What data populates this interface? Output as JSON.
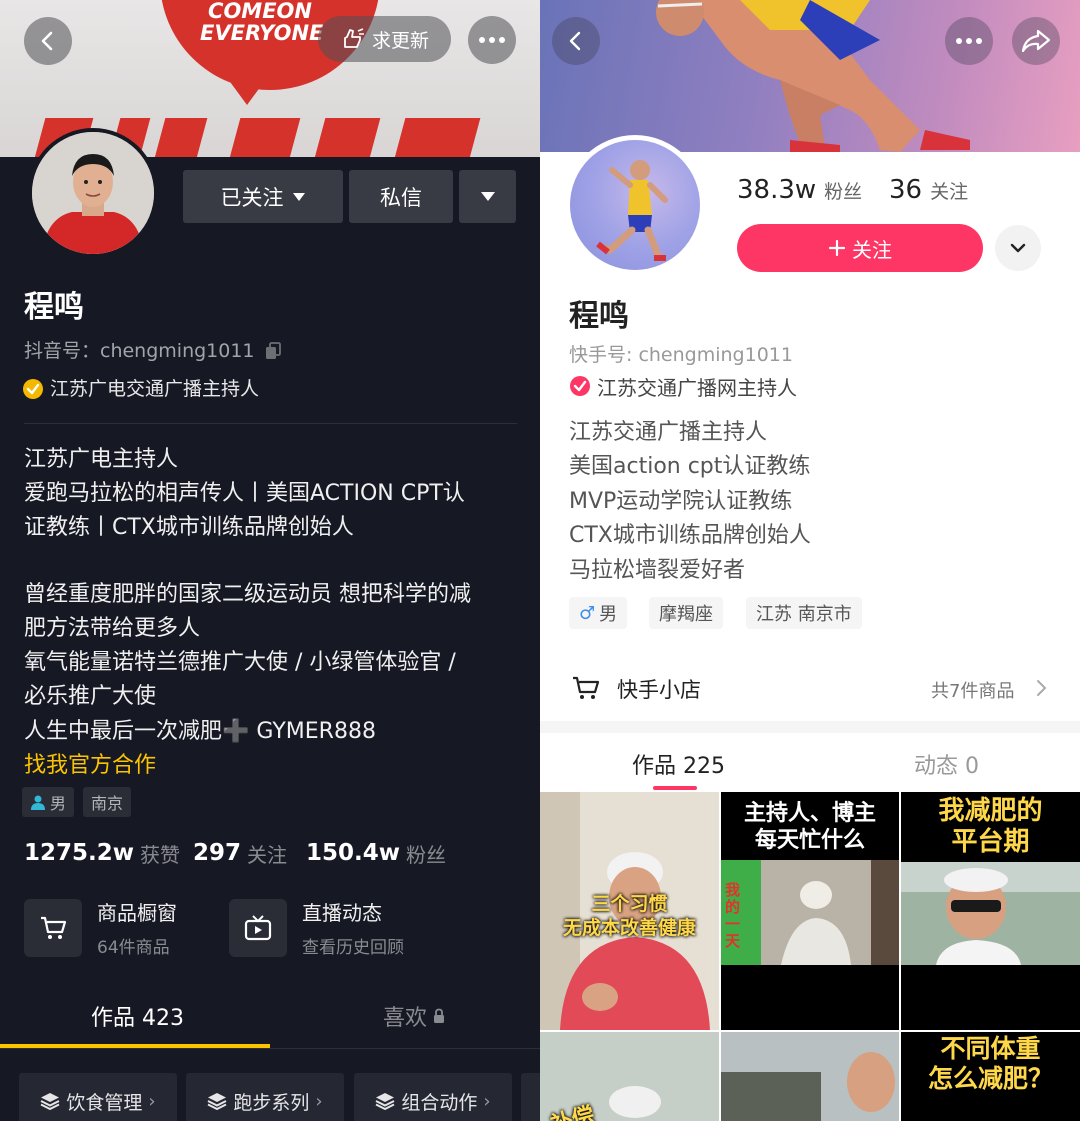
{
  "left": {
    "banner": {
      "text": "COMEON\nEVERYONE"
    },
    "top": {
      "request_update": "求更新"
    },
    "actions": {
      "followed": "已关注",
      "message": "私信"
    },
    "profile": {
      "name": "程鸣",
      "account_id": "抖音号：chengming1011",
      "verification": "江苏广电交通广播主持人"
    },
    "bio": [
      "江苏广电主持人",
      "爱跑马拉松的相声传人丨美国ACTION CPT认",
      "证教练丨CTX城市训练品牌创始人",
      "",
      "曾经重度肥胖的国家二级运动员 想把科学的减",
      "肥方法带给更多人",
      "氧气能量诺特兰德推广大使 / 小绿管体验官 /",
      "必乐推广大使",
      "人生中最后一次减肥➕ GYMER888"
    ],
    "contact_link": "找我官方合作",
    "tags": {
      "gender": "男",
      "location": "南京"
    },
    "stats": [
      {
        "num": "1275.2w",
        "label": "获赞"
      },
      {
        "num": "297",
        "label": "关注"
      },
      {
        "num": "150.4w",
        "label": "粉丝"
      }
    ],
    "cards": [
      {
        "title": "商品橱窗",
        "subtitle": "64件商品"
      },
      {
        "title": "直播动态",
        "subtitle": "查看历史回顾"
      }
    ],
    "tabs": {
      "works": "作品 423",
      "likes": "喜欢"
    },
    "chips": [
      "饮食管理",
      "跑步系列",
      "组合动作"
    ],
    "colors": {
      "bg": "#161823",
      "accent": "#fbc300",
      "verified": "#f5b800"
    }
  },
  "right": {
    "stats": [
      {
        "num": "38.3w",
        "label": "粉丝"
      },
      {
        "num": "36",
        "label": "关注"
      }
    ],
    "follow_button": "关注",
    "profile": {
      "name": "程鸣",
      "account_id": "快手号: chengming1011",
      "verification": "江苏交通广播网主持人"
    },
    "bio": [
      "江苏交通广播主持人",
      "美国action cpt认证教练",
      "MVP运动学院认证教练",
      "CTX城市训练品牌创始人",
      "马拉松墙裂爱好者"
    ],
    "tags": {
      "gender": "男",
      "zodiac": "摩羯座",
      "location": "江苏 南京市"
    },
    "shop": {
      "label": "快手小店",
      "count": "共7件商品"
    },
    "tabs": {
      "works": "作品 225",
      "moments": "动态 0"
    },
    "thumbs": [
      {
        "caption": "三个习惯\n无成本改善健康"
      },
      {
        "caption": "主持人、博主\n每天忙什么",
        "side": "我的一天"
      },
      {
        "caption": "我减肥的\n平台期"
      },
      {
        "caption": "补偿"
      },
      {
        "caption": ""
      },
      {
        "caption": "不同体重\n怎么减肥？"
      }
    ],
    "colors": {
      "follow": "#fe3666",
      "verified": "#fe3666"
    }
  }
}
